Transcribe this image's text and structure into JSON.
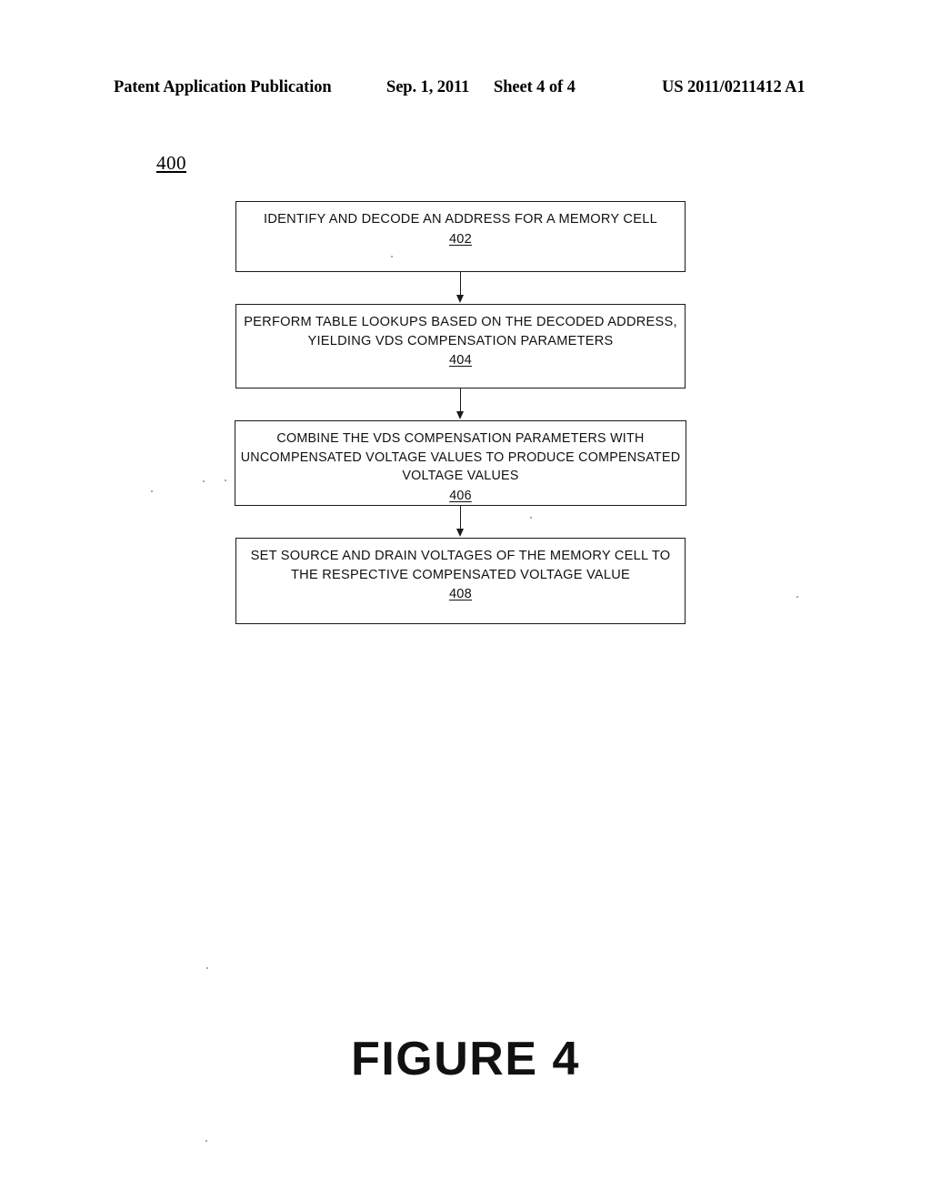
{
  "header": {
    "publication": "Patent Application Publication",
    "date": "Sep. 1, 2011",
    "sheet": "Sheet 4 of 4",
    "patent_number": "US 2011/0211412 A1"
  },
  "figure": {
    "reference_numeral": "400",
    "caption": "FIGURE 4"
  },
  "flowchart": {
    "type": "flowchart",
    "orientation": "vertical",
    "connector": "downward-arrow",
    "steps": [
      {
        "id": "402",
        "text": "IDENTIFY AND DECODE AN ADDRESS FOR A MEMORY CELL",
        "number": "402"
      },
      {
        "id": "404",
        "text": "PERFORM TABLE LOOKUPS BASED ON THE DECODED ADDRESS, YIELDING VDS COMPENSATION PARAMETERS",
        "number": "404"
      },
      {
        "id": "406",
        "text": "COMBINE THE VDS COMPENSATION PARAMETERS WITH UNCOMPENSATED VOLTAGE VALUES TO PRODUCE COMPENSATED VOLTAGE VALUES",
        "number": "406"
      },
      {
        "id": "408",
        "text": "SET SOURCE AND DRAIN VOLTAGES OF THE MEMORY CELL TO THE RESPECTIVE COMPENSATED VOLTAGE VALUE",
        "number": "408"
      }
    ]
  },
  "colors": {
    "page_background": "#ffffff",
    "ink": "#111111",
    "box_border": "#1a1a1a"
  }
}
